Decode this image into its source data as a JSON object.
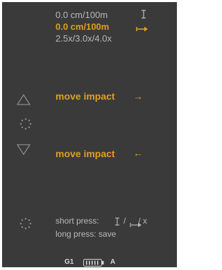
{
  "settings": {
    "row1_text": "0.0  cm/100m",
    "row1_icon": "ibeam-icon",
    "row2_text": "0.0  cm/100m",
    "row2_icon": "double-arrow-icon",
    "row3_text": "2.5x/3.0x/4.0x"
  },
  "actions": {
    "up_label": "move impact",
    "up_arrow": "→",
    "down_label": "move impact",
    "down_arrow": "←"
  },
  "help": {
    "short_press_prefix": "short press:",
    "short_press_sep": "/",
    "short_press_suffix": "/  x",
    "long_press": "long press:  save"
  },
  "status": {
    "profile": "G1",
    "grid": "A",
    "battery_level_fraction": 1.0
  },
  "colors": {
    "background": "#3a3a3a",
    "accent": "#e0a020",
    "text_dim": "#b9b9b9"
  }
}
